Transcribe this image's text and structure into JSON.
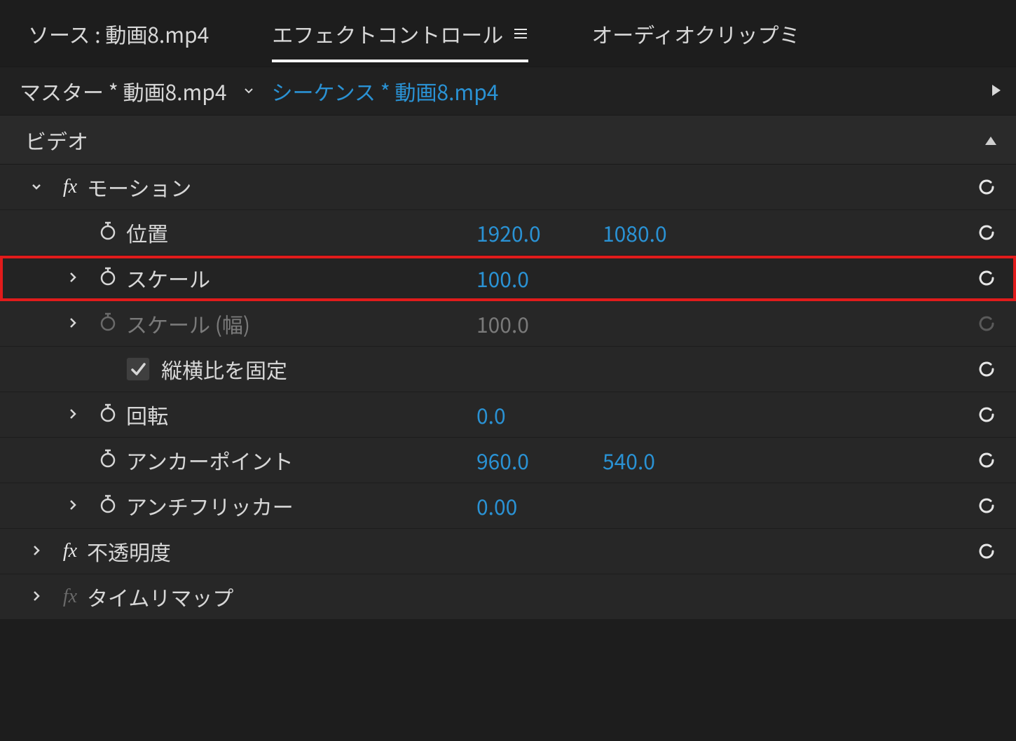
{
  "tabs": {
    "source": "ソース : 動画8.mp4",
    "effects": "エフェクトコントロール",
    "audio": "オーディオクリップミ"
  },
  "breadcrumb": {
    "master": "マスター * 動画8.mp4",
    "sequence": "シーケンス * 動画8.mp4"
  },
  "section": {
    "video": "ビデオ"
  },
  "motion": {
    "label": "モーション",
    "position_label": "位置",
    "position_x": "1920.0",
    "position_y": "1080.0",
    "scale_label": "スケール",
    "scale_value": "100.0",
    "scale_w_label": "スケール (幅)",
    "scale_w_value": "100.0",
    "uniform_label": "縦横比を固定",
    "rotation_label": "回転",
    "rotation_value": "0.0",
    "anchor_label": "アンカーポイント",
    "anchor_x": "960.0",
    "anchor_y": "540.0",
    "antiflicker_label": "アンチフリッカー",
    "antiflicker_value": "0.00"
  },
  "opacity": {
    "label": "不透明度"
  },
  "timeremap": {
    "label": "タイムリマップ"
  },
  "highlight_row": "scale"
}
